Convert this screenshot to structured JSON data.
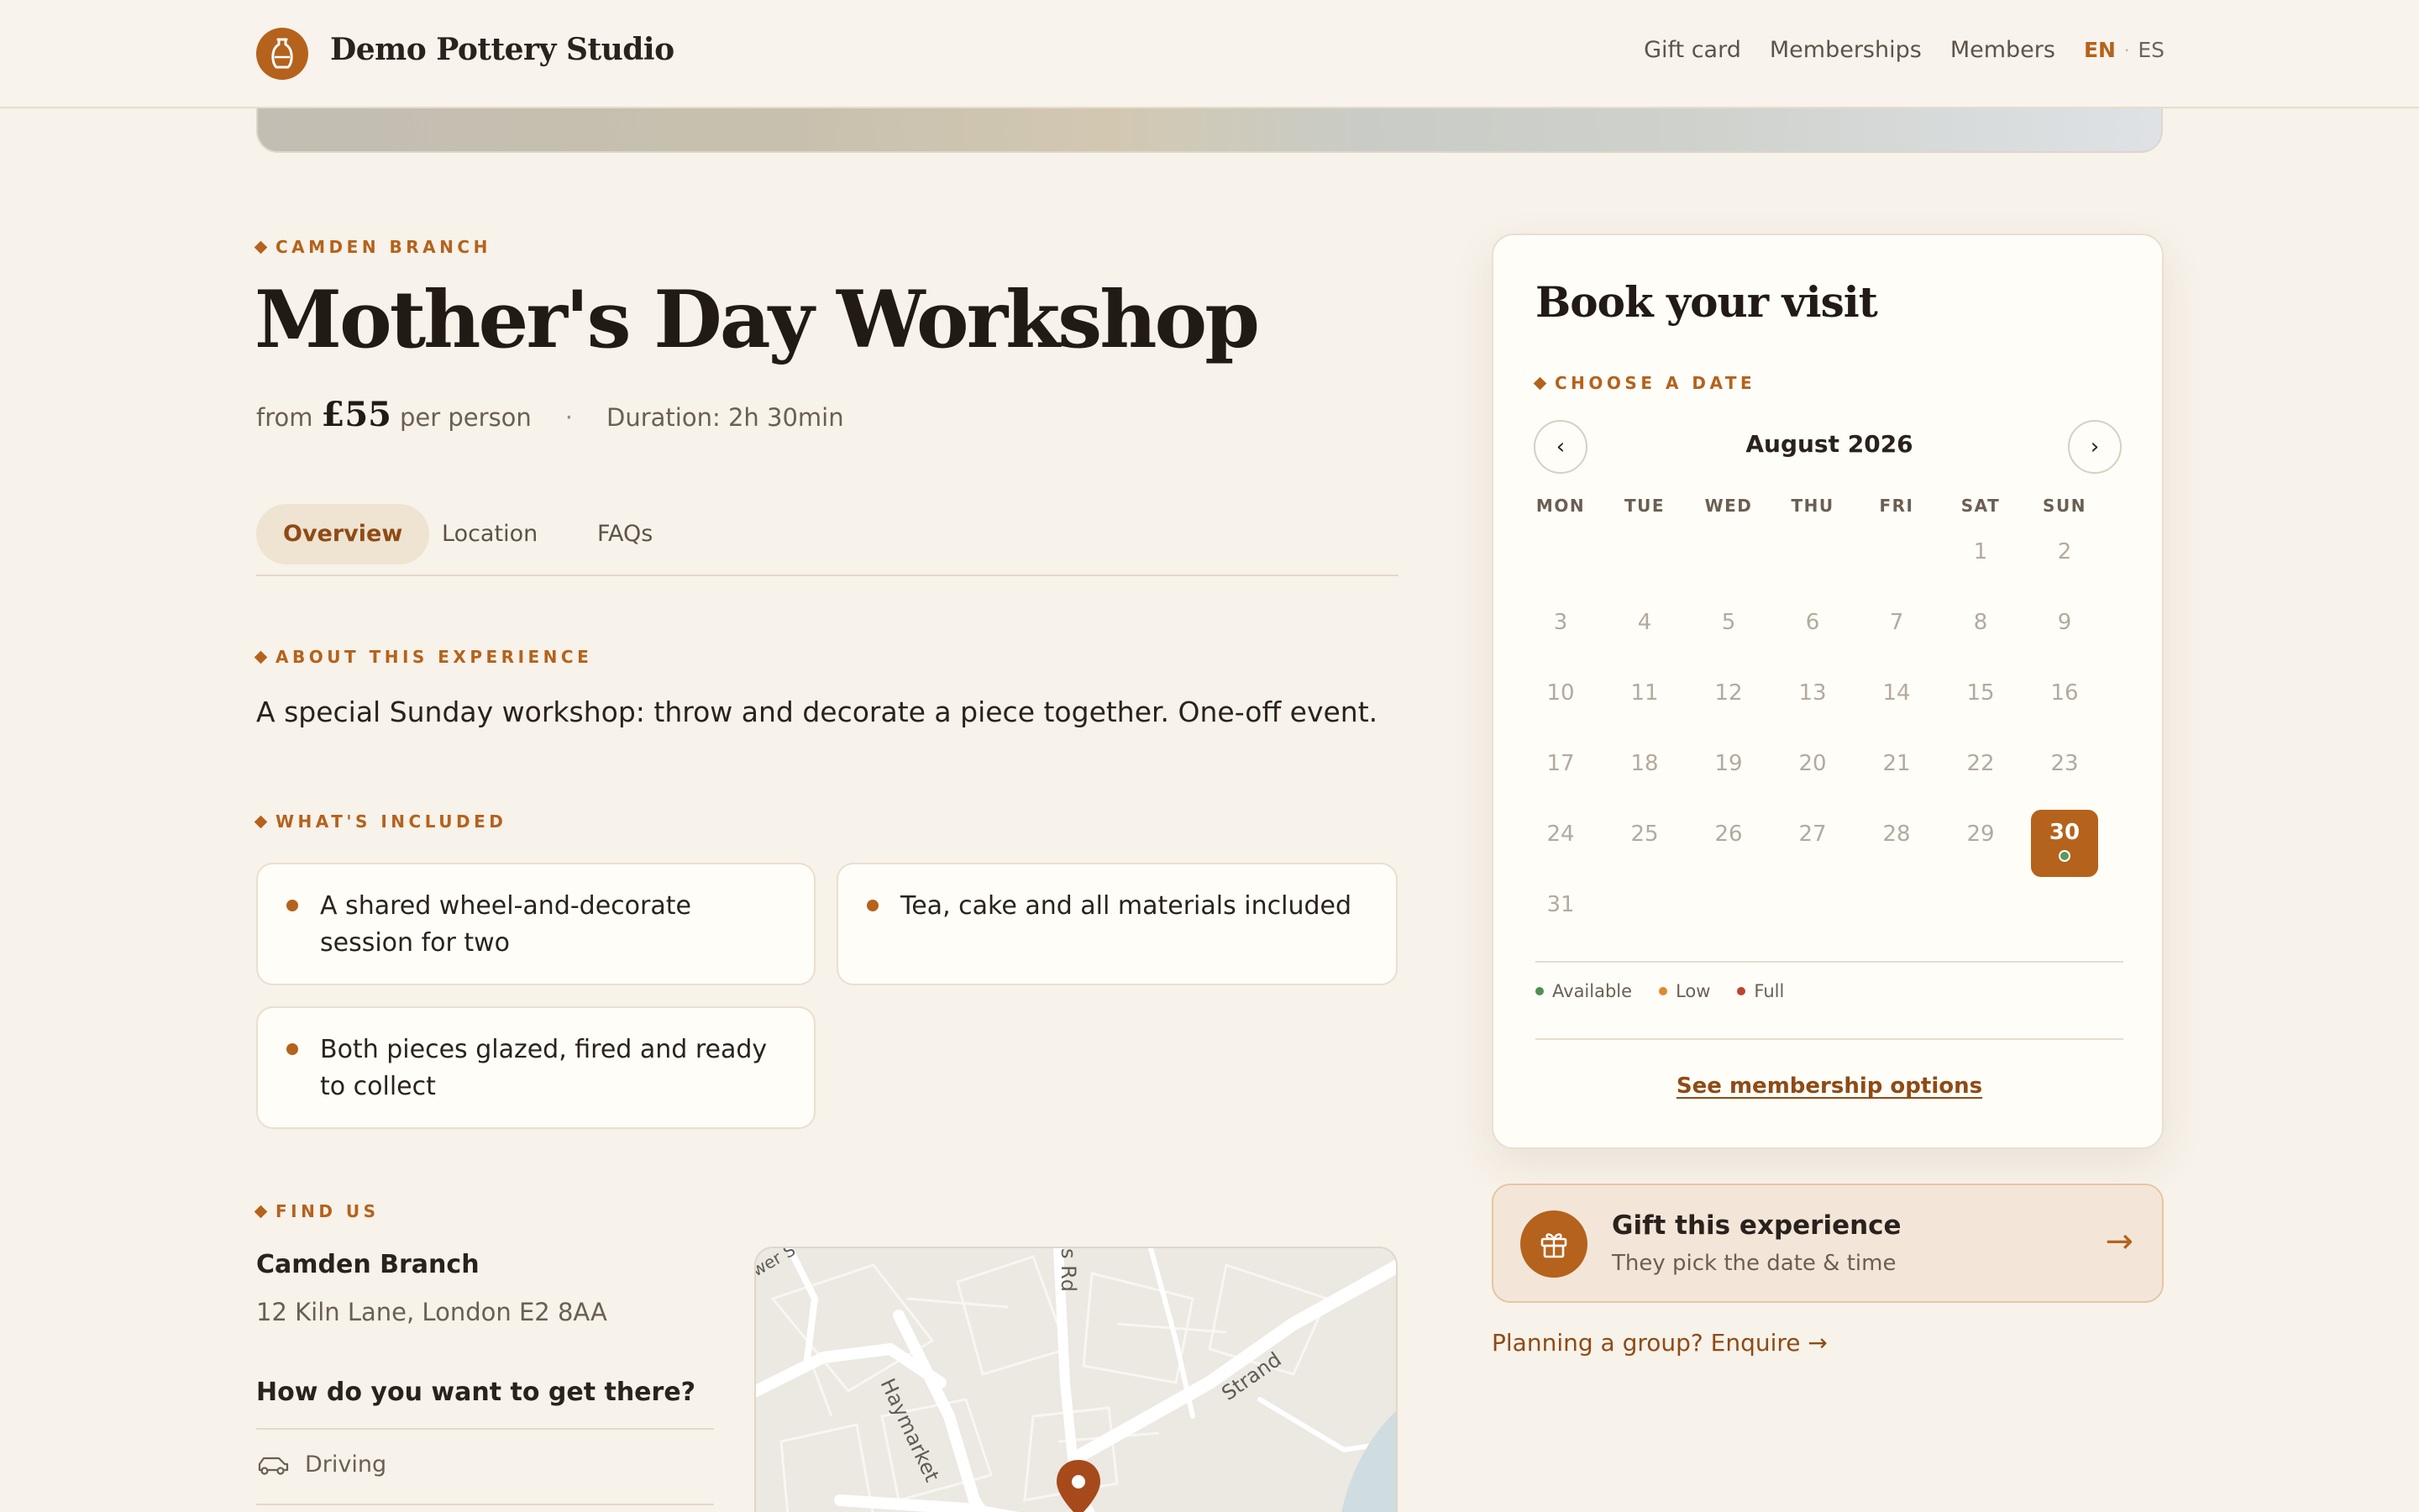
{
  "header": {
    "brand": "Demo Pottery Studio",
    "nav": [
      "Gift card",
      "Memberships",
      "Members"
    ],
    "lang_active": "EN",
    "lang_sep": "·",
    "lang_other": "ES"
  },
  "event": {
    "branch_eyebrow": "CAMDEN BRANCH",
    "title": "Mother's Day Workshop",
    "price_prefix": "from",
    "price": "£55",
    "price_suffix": "per person",
    "separator": "·",
    "duration": "Duration: 2h 30min"
  },
  "tabs": [
    {
      "label": "Overview",
      "active": true
    },
    {
      "label": "Location",
      "active": false
    },
    {
      "label": "FAQs",
      "active": false
    }
  ],
  "about": {
    "eyebrow": "ABOUT THIS EXPERIENCE",
    "text": "A special Sunday workshop: throw and decorate a piece together. One-off event."
  },
  "included": {
    "eyebrow": "WHAT'S INCLUDED",
    "items": [
      "A shared wheel-and-decorate session for two",
      "Tea, cake and all materials included",
      "Both pieces glazed, fired and ready to collect"
    ]
  },
  "find_us": {
    "eyebrow": "FIND US",
    "branch": "Camden Branch",
    "address": "12 Kiln Lane, London E2 8AA",
    "question": "How do you want to get there?",
    "option": "Driving",
    "map_labels": {
      "haymarket": "Haymarket",
      "strand": "Strand",
      "road": "s Rd",
      "lower": "wer S"
    }
  },
  "booking": {
    "title": "Book your visit",
    "eyebrow": "CHOOSE A DATE",
    "prev": "‹",
    "next": "›",
    "month": "August 2026",
    "weekdays": [
      "MON",
      "TUE",
      "WED",
      "THU",
      "FRI",
      "SAT",
      "SUN"
    ],
    "days": [
      "1",
      "2",
      "3",
      "4",
      "5",
      "6",
      "7",
      "8",
      "9",
      "10",
      "11",
      "12",
      "13",
      "14",
      "15",
      "16",
      "17",
      "18",
      "19",
      "20",
      "21",
      "22",
      "23",
      "24",
      "25",
      "26",
      "27",
      "28",
      "29",
      "30",
      "31"
    ],
    "selected_day": "30",
    "legend": [
      {
        "label": "Available",
        "color": "#4f8f4f"
      },
      {
        "label": "Low",
        "color": "#e0892e"
      },
      {
        "label": "Full",
        "color": "#c0432c"
      }
    ],
    "membership_link": "See membership options"
  },
  "gift": {
    "title": "Gift this experience",
    "subtitle": "They pick the date & time",
    "arrow": "→"
  },
  "enquire": "Planning a group? Enquire →",
  "colors": {
    "accent": "#b5621c",
    "background": "#f7f2ea",
    "card": "#fffdf8"
  }
}
